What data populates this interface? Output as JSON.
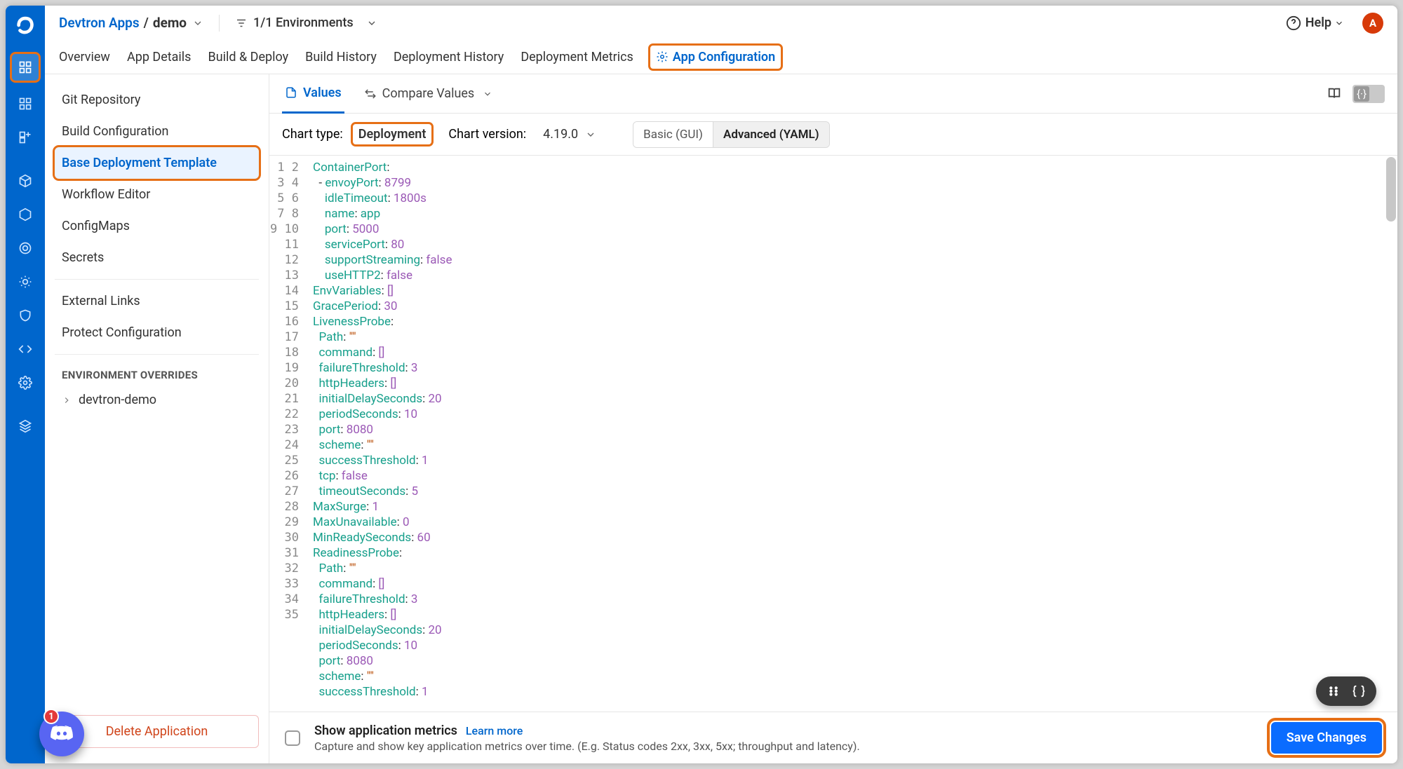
{
  "breadcrumb": {
    "root": "Devtron Apps",
    "sep": "/",
    "leaf": "demo"
  },
  "envFilter": "1/1 Environments",
  "help": "Help",
  "avatar": "A",
  "tabs": {
    "overview": "Overview",
    "appDetails": "App Details",
    "buildDeploy": "Build & Deploy",
    "buildHistory": "Build History",
    "deploymentHistory": "Deployment History",
    "deploymentMetrics": "Deployment Metrics",
    "appConfiguration": "App Configuration"
  },
  "sideNav": {
    "gitRepo": "Git Repository",
    "buildConfig": "Build Configuration",
    "baseDeploy": "Base Deployment Template",
    "workflow": "Workflow Editor",
    "configmaps": "ConfigMaps",
    "secrets": "Secrets",
    "externalLinks": "External Links",
    "protectConfig": "Protect Configuration",
    "envOverrides": "ENVIRONMENT OVERRIDES",
    "envItem": "devtron-demo",
    "deleteApp": "Delete Application"
  },
  "valuesBar": {
    "values": "Values",
    "compare": "Compare Values"
  },
  "chartBar": {
    "typeLabel": "Chart type:",
    "typeValue": "Deployment",
    "versionLabel": "Chart version:",
    "versionValue": "4.19.0",
    "basic": "Basic (GUI)",
    "advanced": "Advanced (YAML)"
  },
  "editorLines": [
    [
      [
        "ContainerPort",
        "key"
      ],
      [
        ":",
        "punct"
      ]
    ],
    [
      [
        "  - ",
        "punct"
      ],
      [
        "envoyPort",
        "key"
      ],
      [
        ": ",
        "punct"
      ],
      [
        "8799",
        "num"
      ]
    ],
    [
      [
        "    ",
        "punct"
      ],
      [
        "idleTimeout",
        "key"
      ],
      [
        ": ",
        "punct"
      ],
      [
        "1800s",
        "num"
      ]
    ],
    [
      [
        "    ",
        "punct"
      ],
      [
        "name",
        "key"
      ],
      [
        ": ",
        "punct"
      ],
      [
        "app",
        "key"
      ]
    ],
    [
      [
        "    ",
        "punct"
      ],
      [
        "port",
        "key"
      ],
      [
        ": ",
        "punct"
      ],
      [
        "5000",
        "num"
      ]
    ],
    [
      [
        "    ",
        "punct"
      ],
      [
        "servicePort",
        "key"
      ],
      [
        ": ",
        "punct"
      ],
      [
        "80",
        "num"
      ]
    ],
    [
      [
        "    ",
        "punct"
      ],
      [
        "supportStreaming",
        "key"
      ],
      [
        ": ",
        "punct"
      ],
      [
        "false",
        "bool"
      ]
    ],
    [
      [
        "    ",
        "punct"
      ],
      [
        "useHTTP2",
        "key"
      ],
      [
        ": ",
        "punct"
      ],
      [
        "false",
        "bool"
      ]
    ],
    [
      [
        "EnvVariables",
        "key"
      ],
      [
        ": ",
        "punct"
      ],
      [
        "[]",
        "num"
      ]
    ],
    [
      [
        "GracePeriod",
        "key"
      ],
      [
        ": ",
        "punct"
      ],
      [
        "30",
        "num"
      ]
    ],
    [
      [
        "LivenessProbe",
        "key"
      ],
      [
        ":",
        "punct"
      ]
    ],
    [
      [
        "  ",
        "punct"
      ],
      [
        "Path",
        "key"
      ],
      [
        ": ",
        "punct"
      ],
      [
        "\"\"",
        "str"
      ]
    ],
    [
      [
        "  ",
        "punct"
      ],
      [
        "command",
        "key"
      ],
      [
        ": ",
        "punct"
      ],
      [
        "[]",
        "num"
      ]
    ],
    [
      [
        "  ",
        "punct"
      ],
      [
        "failureThreshold",
        "key"
      ],
      [
        ": ",
        "punct"
      ],
      [
        "3",
        "num"
      ]
    ],
    [
      [
        "  ",
        "punct"
      ],
      [
        "httpHeaders",
        "key"
      ],
      [
        ": ",
        "punct"
      ],
      [
        "[]",
        "num"
      ]
    ],
    [
      [
        "  ",
        "punct"
      ],
      [
        "initialDelaySeconds",
        "key"
      ],
      [
        ": ",
        "punct"
      ],
      [
        "20",
        "num"
      ]
    ],
    [
      [
        "  ",
        "punct"
      ],
      [
        "periodSeconds",
        "key"
      ],
      [
        ": ",
        "punct"
      ],
      [
        "10",
        "num"
      ]
    ],
    [
      [
        "  ",
        "punct"
      ],
      [
        "port",
        "key"
      ],
      [
        ": ",
        "punct"
      ],
      [
        "8080",
        "num"
      ]
    ],
    [
      [
        "  ",
        "punct"
      ],
      [
        "scheme",
        "key"
      ],
      [
        ": ",
        "punct"
      ],
      [
        "\"\"",
        "str"
      ]
    ],
    [
      [
        "  ",
        "punct"
      ],
      [
        "successThreshold",
        "key"
      ],
      [
        ": ",
        "punct"
      ],
      [
        "1",
        "num"
      ]
    ],
    [
      [
        "  ",
        "punct"
      ],
      [
        "tcp",
        "key"
      ],
      [
        ": ",
        "punct"
      ],
      [
        "false",
        "bool"
      ]
    ],
    [
      [
        "  ",
        "punct"
      ],
      [
        "timeoutSeconds",
        "key"
      ],
      [
        ": ",
        "punct"
      ],
      [
        "5",
        "num"
      ]
    ],
    [
      [
        "MaxSurge",
        "key"
      ],
      [
        ": ",
        "punct"
      ],
      [
        "1",
        "num"
      ]
    ],
    [
      [
        "MaxUnavailable",
        "key"
      ],
      [
        ": ",
        "punct"
      ],
      [
        "0",
        "num"
      ]
    ],
    [
      [
        "MinReadySeconds",
        "key"
      ],
      [
        ": ",
        "punct"
      ],
      [
        "60",
        "num"
      ]
    ],
    [
      [
        "ReadinessProbe",
        "key"
      ],
      [
        ":",
        "punct"
      ]
    ],
    [
      [
        "  ",
        "punct"
      ],
      [
        "Path",
        "key"
      ],
      [
        ": ",
        "punct"
      ],
      [
        "\"\"",
        "str"
      ]
    ],
    [
      [
        "  ",
        "punct"
      ],
      [
        "command",
        "key"
      ],
      [
        ": ",
        "punct"
      ],
      [
        "[]",
        "num"
      ]
    ],
    [
      [
        "  ",
        "punct"
      ],
      [
        "failureThreshold",
        "key"
      ],
      [
        ": ",
        "punct"
      ],
      [
        "3",
        "num"
      ]
    ],
    [
      [
        "  ",
        "punct"
      ],
      [
        "httpHeaders",
        "key"
      ],
      [
        ": ",
        "punct"
      ],
      [
        "[]",
        "num"
      ]
    ],
    [
      [
        "  ",
        "punct"
      ],
      [
        "initialDelaySeconds",
        "key"
      ],
      [
        ": ",
        "punct"
      ],
      [
        "20",
        "num"
      ]
    ],
    [
      [
        "  ",
        "punct"
      ],
      [
        "periodSeconds",
        "key"
      ],
      [
        ": ",
        "punct"
      ],
      [
        "10",
        "num"
      ]
    ],
    [
      [
        "  ",
        "punct"
      ],
      [
        "port",
        "key"
      ],
      [
        ": ",
        "punct"
      ],
      [
        "8080",
        "num"
      ]
    ],
    [
      [
        "  ",
        "punct"
      ],
      [
        "scheme",
        "key"
      ],
      [
        ": ",
        "punct"
      ],
      [
        "\"\"",
        "str"
      ]
    ],
    [
      [
        "  ",
        "punct"
      ],
      [
        "successThreshold",
        "key"
      ],
      [
        ": ",
        "punct"
      ],
      [
        "1",
        "num"
      ]
    ]
  ],
  "footer": {
    "title": "Show application metrics",
    "learnMore": "Learn more",
    "desc": "Capture and show key application metrics over time. (E.g. Status codes 2xx, 3xx, 5xx; throughput and latency).",
    "save": "Save Changes"
  },
  "discordBadge": "1",
  "jsonToggle": "{·}"
}
